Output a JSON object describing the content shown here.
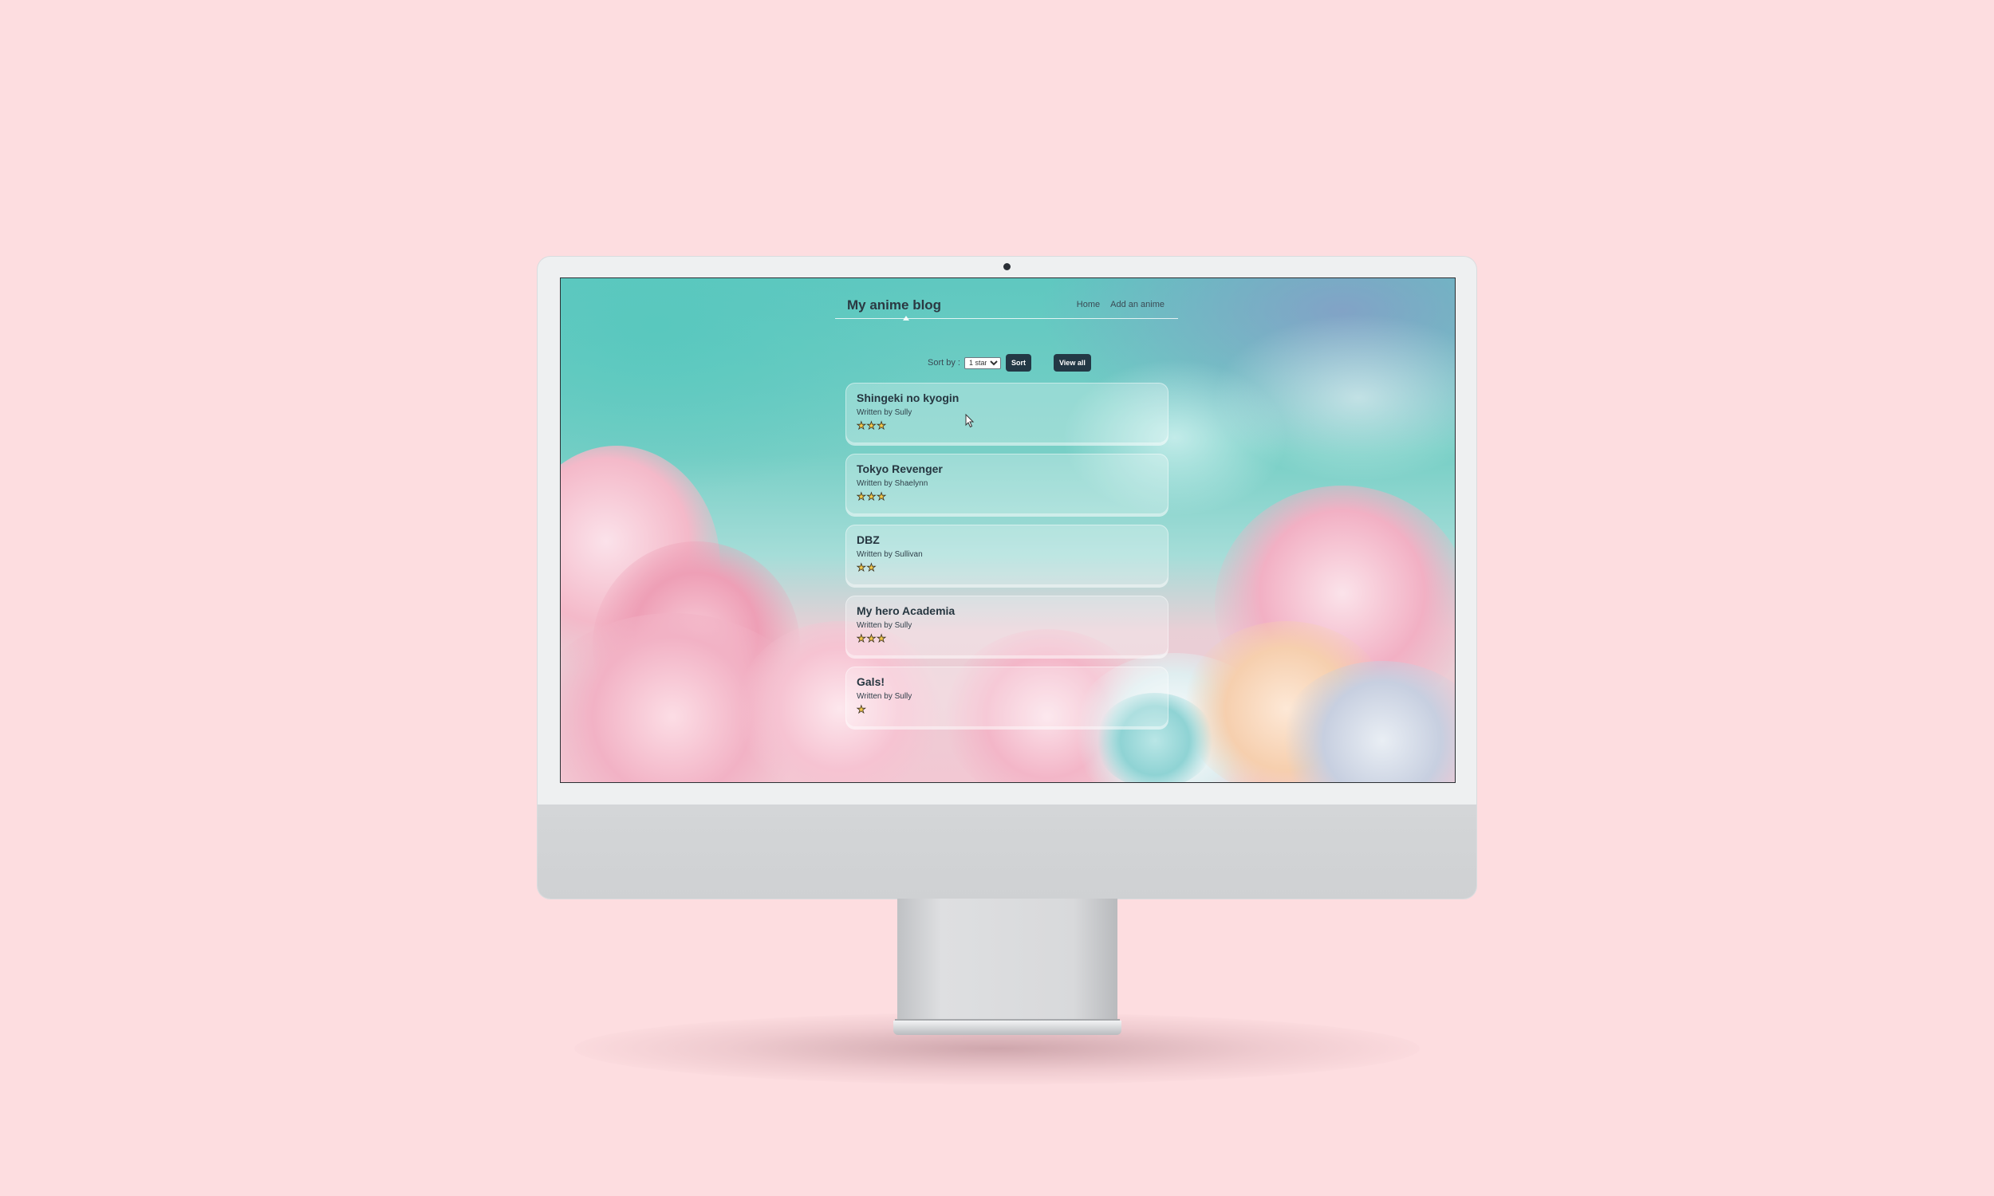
{
  "app": {
    "brand": "My anime blog"
  },
  "nav": {
    "items": [
      {
        "label": "Home"
      },
      {
        "label": "Add an anime"
      }
    ]
  },
  "sort": {
    "label": "Sort by :",
    "selected": "1 star",
    "sort_button": "Sort",
    "view_all_button": "View all"
  },
  "posts": [
    {
      "title": "Shingeki no kyogin",
      "author": "Written by Sully",
      "rating": 3
    },
    {
      "title": "Tokyo Revenger",
      "author": "Written by Shaelynn",
      "rating": 3
    },
    {
      "title": "DBZ",
      "author": "Written by Sullivan",
      "rating": 2
    },
    {
      "title": "My hero Academia",
      "author": "Written by Sully",
      "rating": 3
    },
    {
      "title": "Gals!",
      "author": "Written by Sully",
      "rating": 1
    }
  ],
  "colors": {
    "page_background": "#fddde0",
    "button": "#233845",
    "star_fill": "#f3c84a"
  },
  "icons": {
    "rating": "star-icon",
    "cursor": "mouse-pointer-icon"
  }
}
